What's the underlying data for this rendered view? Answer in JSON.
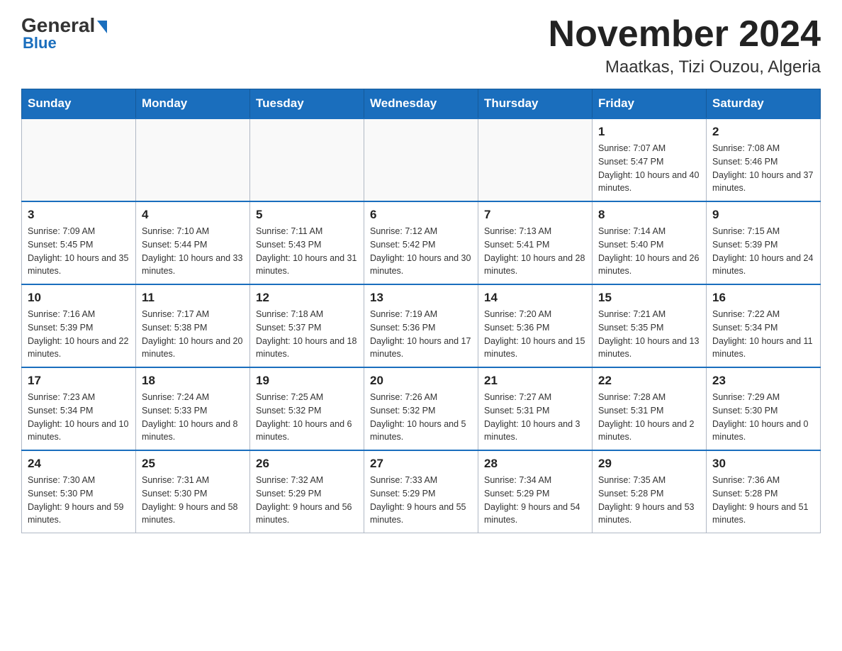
{
  "header": {
    "logo_main": "General",
    "logo_sub": "Blue",
    "title": "November 2024",
    "subtitle": "Maatkas, Tizi Ouzou, Algeria"
  },
  "weekdays": [
    "Sunday",
    "Monday",
    "Tuesday",
    "Wednesday",
    "Thursday",
    "Friday",
    "Saturday"
  ],
  "weeks": [
    [
      {
        "day": "",
        "info": ""
      },
      {
        "day": "",
        "info": ""
      },
      {
        "day": "",
        "info": ""
      },
      {
        "day": "",
        "info": ""
      },
      {
        "day": "",
        "info": ""
      },
      {
        "day": "1",
        "info": "Sunrise: 7:07 AM\nSunset: 5:47 PM\nDaylight: 10 hours and 40 minutes."
      },
      {
        "day": "2",
        "info": "Sunrise: 7:08 AM\nSunset: 5:46 PM\nDaylight: 10 hours and 37 minutes."
      }
    ],
    [
      {
        "day": "3",
        "info": "Sunrise: 7:09 AM\nSunset: 5:45 PM\nDaylight: 10 hours and 35 minutes."
      },
      {
        "day": "4",
        "info": "Sunrise: 7:10 AM\nSunset: 5:44 PM\nDaylight: 10 hours and 33 minutes."
      },
      {
        "day": "5",
        "info": "Sunrise: 7:11 AM\nSunset: 5:43 PM\nDaylight: 10 hours and 31 minutes."
      },
      {
        "day": "6",
        "info": "Sunrise: 7:12 AM\nSunset: 5:42 PM\nDaylight: 10 hours and 30 minutes."
      },
      {
        "day": "7",
        "info": "Sunrise: 7:13 AM\nSunset: 5:41 PM\nDaylight: 10 hours and 28 minutes."
      },
      {
        "day": "8",
        "info": "Sunrise: 7:14 AM\nSunset: 5:40 PM\nDaylight: 10 hours and 26 minutes."
      },
      {
        "day": "9",
        "info": "Sunrise: 7:15 AM\nSunset: 5:39 PM\nDaylight: 10 hours and 24 minutes."
      }
    ],
    [
      {
        "day": "10",
        "info": "Sunrise: 7:16 AM\nSunset: 5:39 PM\nDaylight: 10 hours and 22 minutes."
      },
      {
        "day": "11",
        "info": "Sunrise: 7:17 AM\nSunset: 5:38 PM\nDaylight: 10 hours and 20 minutes."
      },
      {
        "day": "12",
        "info": "Sunrise: 7:18 AM\nSunset: 5:37 PM\nDaylight: 10 hours and 18 minutes."
      },
      {
        "day": "13",
        "info": "Sunrise: 7:19 AM\nSunset: 5:36 PM\nDaylight: 10 hours and 17 minutes."
      },
      {
        "day": "14",
        "info": "Sunrise: 7:20 AM\nSunset: 5:36 PM\nDaylight: 10 hours and 15 minutes."
      },
      {
        "day": "15",
        "info": "Sunrise: 7:21 AM\nSunset: 5:35 PM\nDaylight: 10 hours and 13 minutes."
      },
      {
        "day": "16",
        "info": "Sunrise: 7:22 AM\nSunset: 5:34 PM\nDaylight: 10 hours and 11 minutes."
      }
    ],
    [
      {
        "day": "17",
        "info": "Sunrise: 7:23 AM\nSunset: 5:34 PM\nDaylight: 10 hours and 10 minutes."
      },
      {
        "day": "18",
        "info": "Sunrise: 7:24 AM\nSunset: 5:33 PM\nDaylight: 10 hours and 8 minutes."
      },
      {
        "day": "19",
        "info": "Sunrise: 7:25 AM\nSunset: 5:32 PM\nDaylight: 10 hours and 6 minutes."
      },
      {
        "day": "20",
        "info": "Sunrise: 7:26 AM\nSunset: 5:32 PM\nDaylight: 10 hours and 5 minutes."
      },
      {
        "day": "21",
        "info": "Sunrise: 7:27 AM\nSunset: 5:31 PM\nDaylight: 10 hours and 3 minutes."
      },
      {
        "day": "22",
        "info": "Sunrise: 7:28 AM\nSunset: 5:31 PM\nDaylight: 10 hours and 2 minutes."
      },
      {
        "day": "23",
        "info": "Sunrise: 7:29 AM\nSunset: 5:30 PM\nDaylight: 10 hours and 0 minutes."
      }
    ],
    [
      {
        "day": "24",
        "info": "Sunrise: 7:30 AM\nSunset: 5:30 PM\nDaylight: 9 hours and 59 minutes."
      },
      {
        "day": "25",
        "info": "Sunrise: 7:31 AM\nSunset: 5:30 PM\nDaylight: 9 hours and 58 minutes."
      },
      {
        "day": "26",
        "info": "Sunrise: 7:32 AM\nSunset: 5:29 PM\nDaylight: 9 hours and 56 minutes."
      },
      {
        "day": "27",
        "info": "Sunrise: 7:33 AM\nSunset: 5:29 PM\nDaylight: 9 hours and 55 minutes."
      },
      {
        "day": "28",
        "info": "Sunrise: 7:34 AM\nSunset: 5:29 PM\nDaylight: 9 hours and 54 minutes."
      },
      {
        "day": "29",
        "info": "Sunrise: 7:35 AM\nSunset: 5:28 PM\nDaylight: 9 hours and 53 minutes."
      },
      {
        "day": "30",
        "info": "Sunrise: 7:36 AM\nSunset: 5:28 PM\nDaylight: 9 hours and 51 minutes."
      }
    ]
  ]
}
